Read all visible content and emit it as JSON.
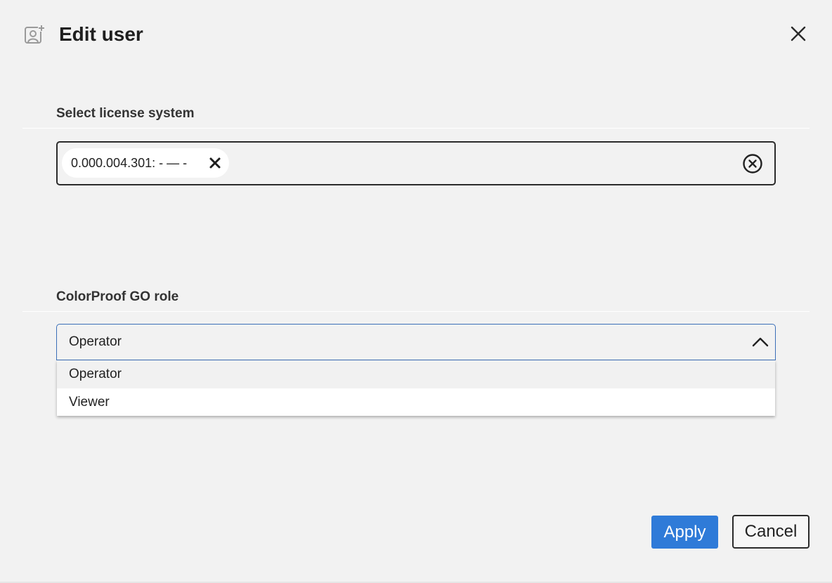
{
  "dialog": {
    "title": "Edit user",
    "header_icon": "user-add-icon",
    "close_icon": "close-icon"
  },
  "license": {
    "label": "Select license system",
    "chips": [
      {
        "text": "0.000.004.301: - — -",
        "remove_icon": "close-icon"
      }
    ],
    "clear_icon": "clear-circle-icon"
  },
  "role": {
    "label": "ColorProof GO role",
    "selected": "Operator",
    "expanded": true,
    "options": [
      "Operator",
      "Viewer"
    ],
    "highlighted_option": "Operator"
  },
  "actions": {
    "apply_label": "Apply",
    "cancel_label": "Cancel"
  },
  "colors": {
    "accent": "#2f7bd8",
    "background": "#f2f2f2",
    "focus_border": "#3b6fb8"
  }
}
